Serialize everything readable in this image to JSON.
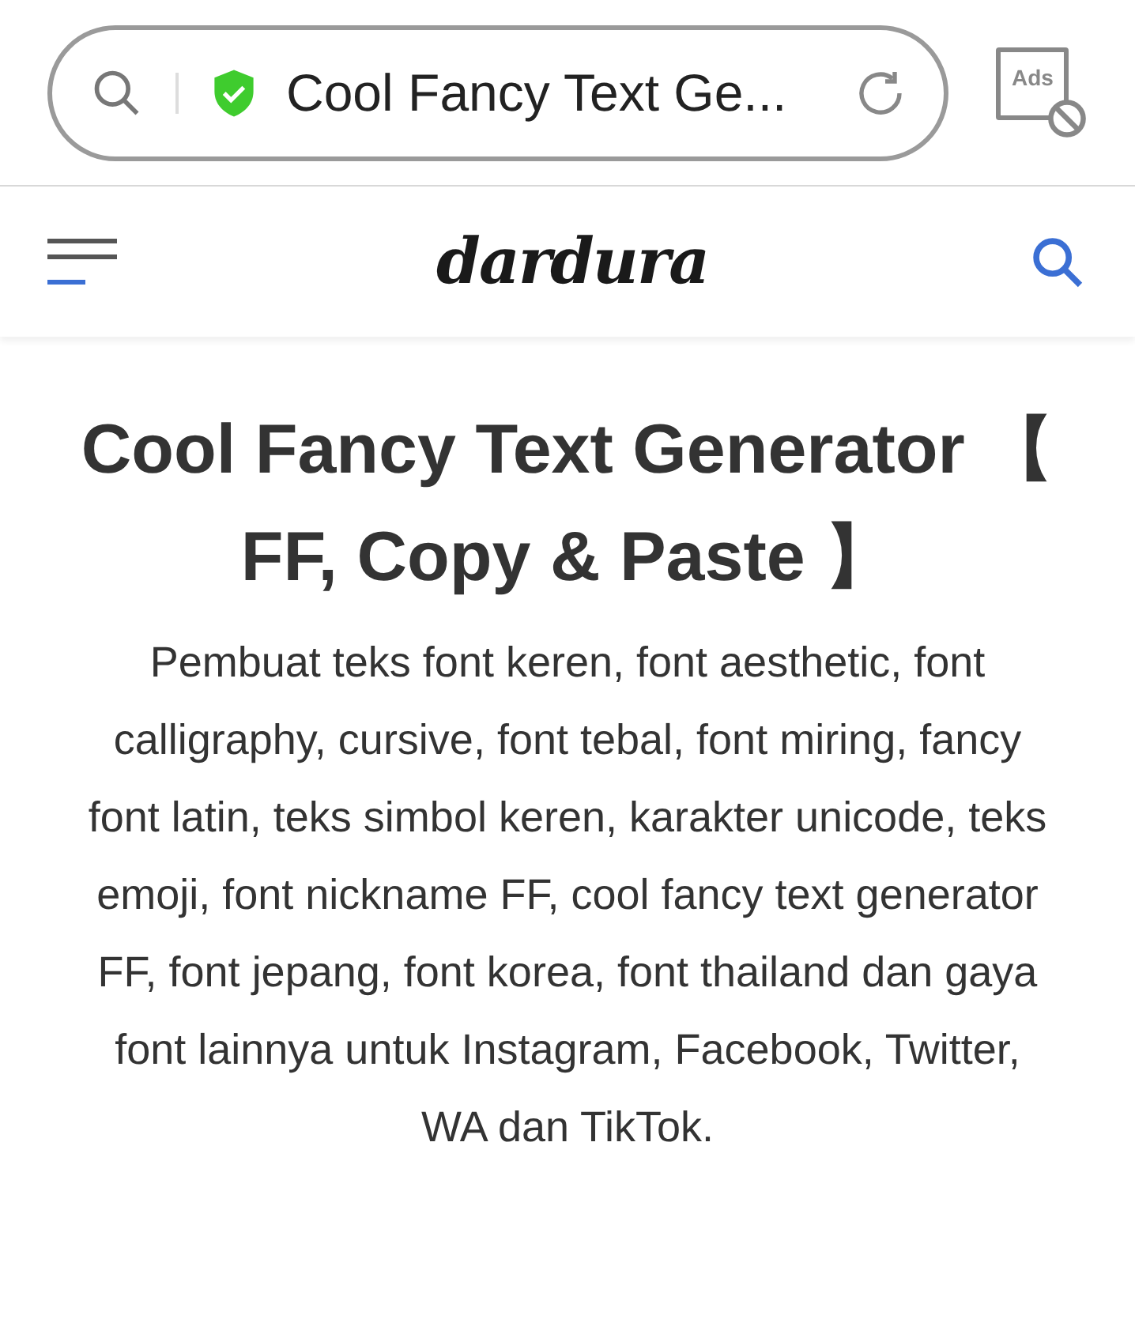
{
  "browser": {
    "address": "Cool Fancy Text Ge...",
    "ads_label": "Ads"
  },
  "site": {
    "logo": "dardura"
  },
  "article": {
    "title": "Cool Fancy Text Generator 【 FF, Copy & Paste 】",
    "description": "Pembuat teks font keren, font aesthetic, font calligraphy, cursive, font tebal, font miring, fancy font latin, teks simbol keren, karakter unicode, teks emoji, font nickname FF, cool fancy text generator FF, font jepang, font korea, font thailand dan gaya font lainnya untuk Instagram, Facebook, Twitter, WA dan TikTok."
  }
}
